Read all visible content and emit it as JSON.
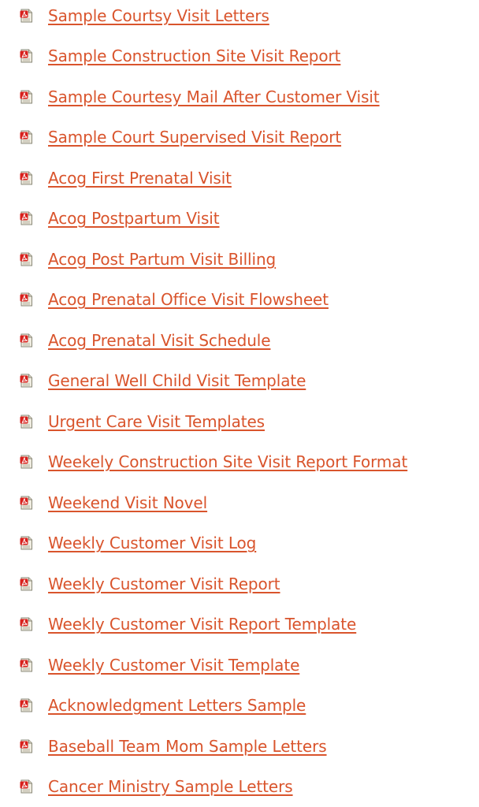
{
  "documents": [
    {
      "title": "Sample Courtsy Visit Letters",
      "icon": "pdf-file-icon"
    },
    {
      "title": "Sample Construction Site Visit Report",
      "icon": "pdf-file-icon"
    },
    {
      "title": "Sample Courtesy Mail After Customer Visit",
      "icon": "pdf-file-icon"
    },
    {
      "title": "Sample Court Supervised Visit Report",
      "icon": "pdf-file-icon"
    },
    {
      "title": "Acog First Prenatal Visit",
      "icon": "pdf-file-icon"
    },
    {
      "title": "Acog Postpartum Visit",
      "icon": "pdf-file-icon"
    },
    {
      "title": "Acog Post Partum Visit Billing",
      "icon": "pdf-file-icon"
    },
    {
      "title": "Acog Prenatal Office Visit Flowsheet",
      "icon": "pdf-file-icon"
    },
    {
      "title": "Acog Prenatal Visit Schedule",
      "icon": "pdf-file-icon"
    },
    {
      "title": "General Well Child Visit Template",
      "icon": "pdf-file-icon"
    },
    {
      "title": "Urgent Care Visit Templates",
      "icon": "pdf-file-icon"
    },
    {
      "title": "Weekely Construction Site Visit Report Format",
      "icon": "pdf-file-icon"
    },
    {
      "title": "Weekend Visit Novel",
      "icon": "pdf-file-icon"
    },
    {
      "title": "Weekly Customer Visit Log",
      "icon": "pdf-file-icon"
    },
    {
      "title": "Weekly Customer Visit Report",
      "icon": "pdf-file-icon"
    },
    {
      "title": "Weekly Customer Visit Report Template",
      "icon": "pdf-file-icon"
    },
    {
      "title": "Weekly Customer Visit Template",
      "icon": "pdf-file-icon"
    },
    {
      "title": "Acknowledgment Letters Sample",
      "icon": "pdf-file-icon"
    },
    {
      "title": "Baseball Team Mom Sample Letters",
      "icon": "pdf-file-icon"
    },
    {
      "title": "Cancer Ministry Sample Letters",
      "icon": "pdf-file-icon"
    }
  ],
  "colors": {
    "link": "#d9542c",
    "icon_red": "#d8211d",
    "icon_paper": "#e8e4d4"
  }
}
